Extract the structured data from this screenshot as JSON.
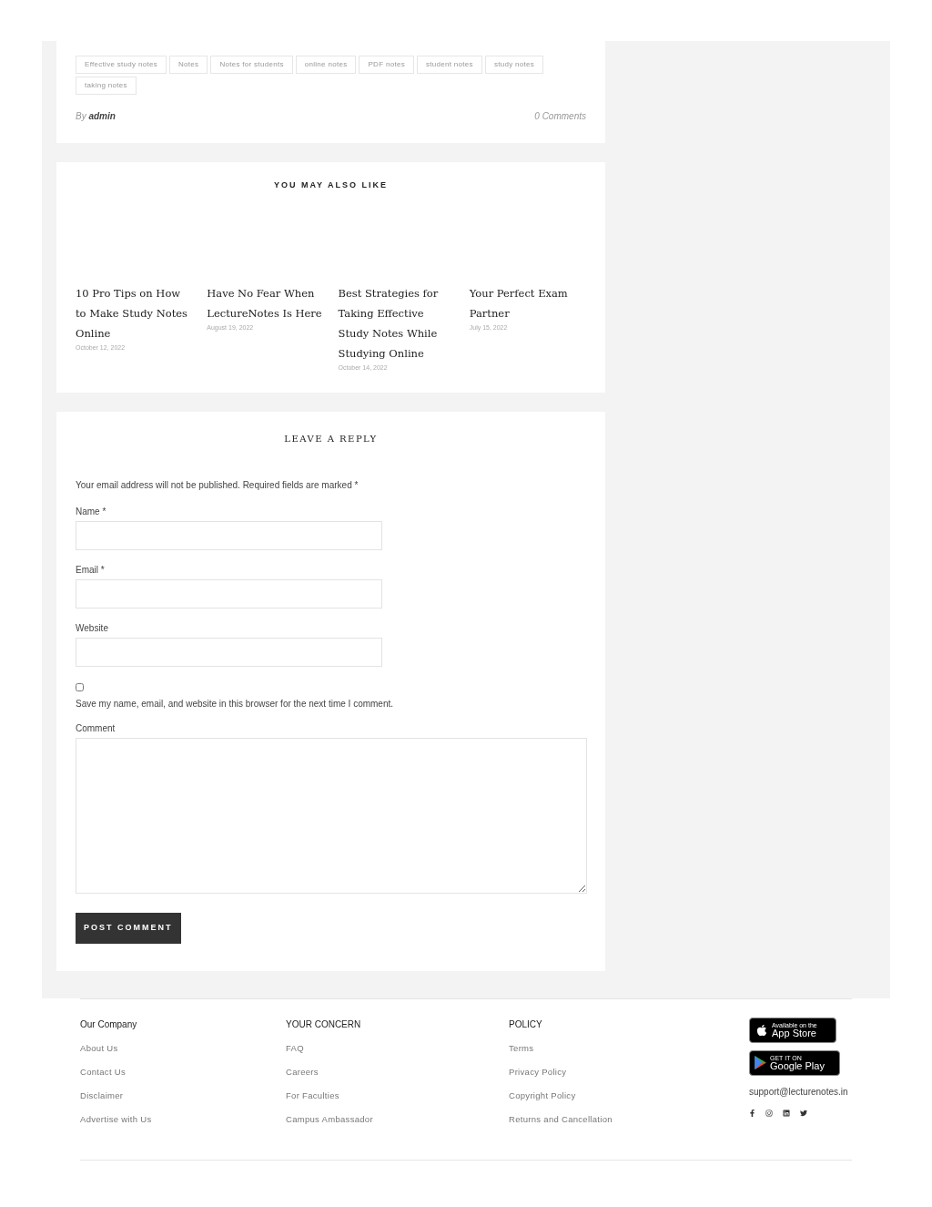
{
  "post_meta": {
    "tags": [
      "Effective study notes",
      "Notes",
      "Notes for students",
      "online notes",
      "PDF notes",
      "student notes",
      "study notes",
      "taking notes"
    ],
    "author_prefix": "By",
    "author": "admin",
    "comments": "0 Comments"
  },
  "related": {
    "heading": "YOU MAY ALSO LIKE",
    "posts": [
      {
        "title": "10 Pro Tips on How to Make Study Notes Online",
        "date": "October 12, 2022"
      },
      {
        "title": "Have No Fear When LectureNotes Is Here",
        "date": "August 19, 2022"
      },
      {
        "title": "Best Strategies for Taking Effective Study Notes While Studying Online",
        "date": "October 14, 2022"
      },
      {
        "title": "Your Perfect Exam Partner",
        "date": "July 15, 2022"
      }
    ]
  },
  "reply": {
    "heading": "LEAVE A REPLY",
    "notice": "Your email address will not be published. Required fields are marked *",
    "fields": [
      {
        "label": "Name *"
      },
      {
        "label": "Email *"
      },
      {
        "label": "Website"
      }
    ],
    "save_info": {
      "checked": false,
      "label": "Save my name, email, and website in this browser for the next time I comment."
    },
    "comment_label": "Comment",
    "submit": "POST COMMENT"
  },
  "footer": {
    "columns": [
      {
        "heading": "Our Company",
        "links": [
          "About Us",
          "Contact Us",
          "Disclaimer",
          "Advertise with Us"
        ]
      },
      {
        "heading": "YOUR CONCERN",
        "links": [
          "FAQ",
          "Careers",
          "For Faculties",
          "Campus Ambassador"
        ]
      },
      {
        "heading": "POLICY",
        "links": [
          "Terms",
          "Privacy Policy",
          "Copyright Policy",
          "Returns and Cancellation"
        ]
      }
    ],
    "app_store": {
      "small": "Available on the",
      "big": "App Store"
    },
    "google_play": {
      "small": "GET IT ON",
      "big": "Google Play"
    },
    "email": "support@lecturenotes.in"
  }
}
